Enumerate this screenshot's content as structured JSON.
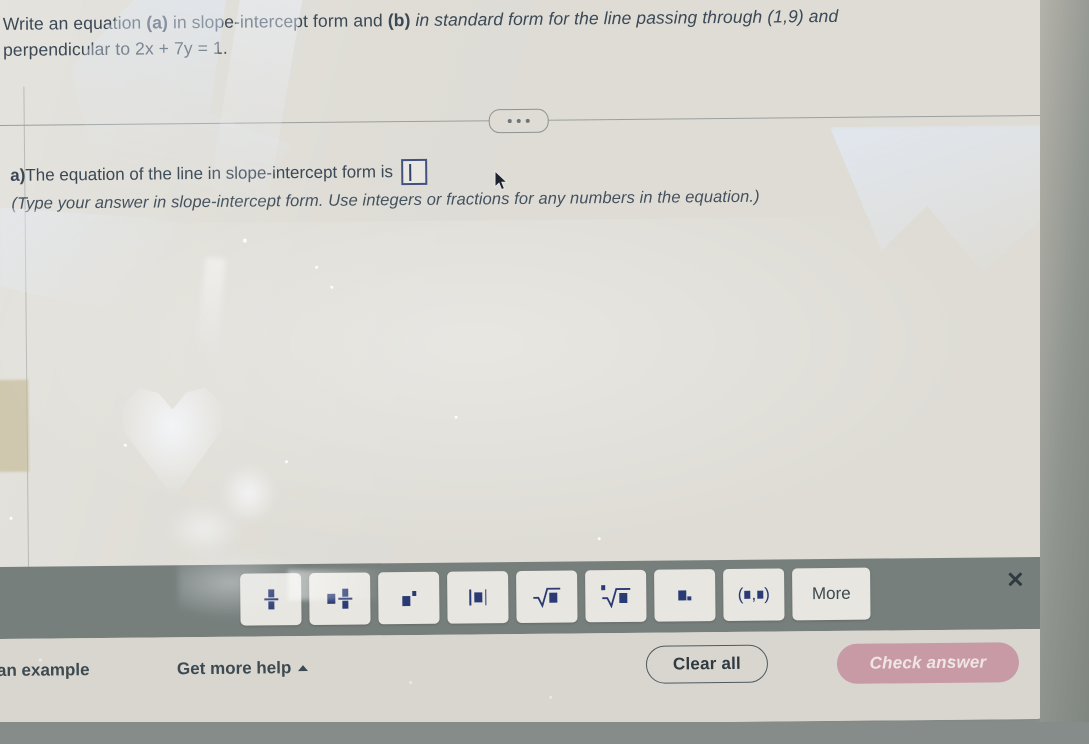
{
  "question": {
    "line1_pre": "Write an equation ",
    "line1_a": "(a)",
    "line1_mid": " in slope-intercept form and ",
    "line1_b": "(b)",
    "line1_post": " in standard form for the line passing through (1,9) and",
    "line2": "perpendicular to 2x + 7y = 1."
  },
  "divider": {
    "menu_dots": "•••"
  },
  "part_a": {
    "label": "a)",
    "text": " The equation of the line in slope-intercept form is",
    "answer_value": "",
    "hint": "(Type your answer in slope-intercept form. Use integers or fractions for any numbers in the equation.)"
  },
  "keypad": {
    "keys": [
      {
        "name": "fraction",
        "glyph": "fraction",
        "label": "▪/▪"
      },
      {
        "name": "mixed-number",
        "glyph": "mixed",
        "label": "▪ ▪/▪"
      },
      {
        "name": "exponent",
        "glyph": "exponent",
        "label": "▪^▪"
      },
      {
        "name": "absolute-value",
        "glyph": "abs",
        "label": "|▪|"
      },
      {
        "name": "square-root",
        "glyph": "sqrt",
        "label": "√▪"
      },
      {
        "name": "nth-root",
        "glyph": "nthroot",
        "label": "ⁿ√▪"
      },
      {
        "name": "subscript",
        "glyph": "subscript",
        "label": "▪."
      },
      {
        "name": "ordered-pair",
        "glyph": "pair",
        "label": "(▪,▪)"
      },
      {
        "name": "more",
        "glyph": "text",
        "label": "More"
      }
    ],
    "close_label": "✕"
  },
  "footer": {
    "view_example": "w an example",
    "get_more_help": "Get more help",
    "clear_all": "Clear all",
    "check_answer": "Check answer"
  },
  "colors": {
    "page_background": "#dedcd5",
    "keypad_band": "#777f7d",
    "footer_background": "#d8d6cf",
    "answer_box_border": "#44517f",
    "math_glyph": "#2a3a74",
    "check_answer_button": "#c79aa5",
    "text": "#3b4856"
  }
}
